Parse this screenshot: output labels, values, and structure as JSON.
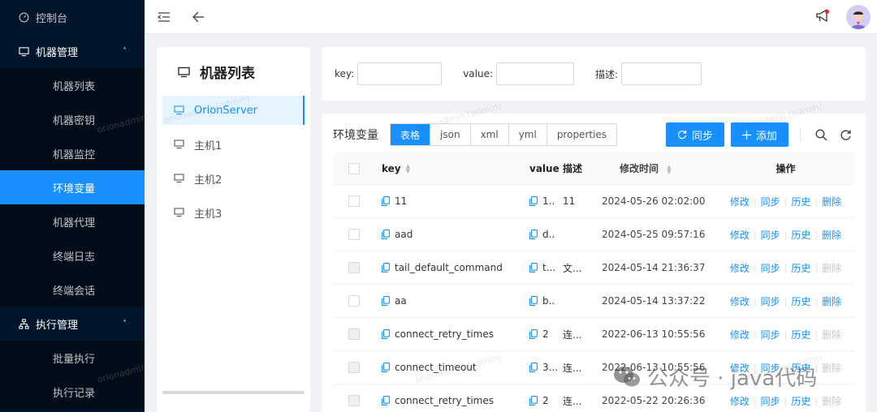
{
  "sidebar": {
    "dashboard": "控制台",
    "machine_group": "机器管理",
    "machine_items": [
      "机器列表",
      "机器密钥",
      "机器监控",
      "环境变量",
      "机器代理",
      "终端日志",
      "终端会话"
    ],
    "exec_group": "执行管理",
    "exec_items": [
      "批量执行",
      "执行记录"
    ]
  },
  "machine_panel": {
    "title": "机器列表",
    "items": [
      "OrionServer",
      "主机1",
      "主机2",
      "主机3"
    ]
  },
  "search": {
    "key_label": "key",
    "value_label": "value",
    "desc_label": "描述"
  },
  "toolbar": {
    "title": "环境变量",
    "views": [
      "表格",
      "json",
      "xml",
      "yml",
      "properties"
    ],
    "sync_label": "同步",
    "add_label": "添加"
  },
  "table": {
    "headers": {
      "key": "key",
      "value": "value",
      "desc": "描述",
      "time": "修改时间",
      "ops": "操作"
    },
    "op_labels": {
      "edit": "修改",
      "sync": "同步",
      "history": "历史",
      "delete": "删除"
    },
    "rows": [
      {
        "key": "11",
        "value": "1..",
        "desc": "11",
        "time": "2024-05-26 02:02:00",
        "deletable": true
      },
      {
        "key": "aad",
        "value": "d..",
        "desc": "",
        "time": "2024-05-25 09:57:16",
        "deletable": true
      },
      {
        "key": "tail_default_command",
        "value": "t...",
        "desc": "文...",
        "time": "2024-05-14 21:36:37",
        "deletable": false
      },
      {
        "key": "aa",
        "value": "b..",
        "desc": "",
        "time": "2024-05-14 13:37:22",
        "deletable": true
      },
      {
        "key": "connect_retry_times",
        "value": "2",
        "desc": "连...",
        "time": "2022-06-13 10:55:56",
        "deletable": false
      },
      {
        "key": "connect_timeout",
        "value": "3...",
        "desc": "连...",
        "time": "2022-06-13 10:55:56",
        "deletable": false
      },
      {
        "key": "connect_retry_times",
        "value": "2",
        "desc": "连...",
        "time": "2022-05-22 20:26:36",
        "deletable": false
      }
    ]
  },
  "watermark": "orionadmin (admin)",
  "footer_watermark": "公众号 · java代码",
  "colors": {
    "primary": "#1890ff",
    "sidebar_bg": "#001529",
    "disabled": "#c8c8c8"
  }
}
